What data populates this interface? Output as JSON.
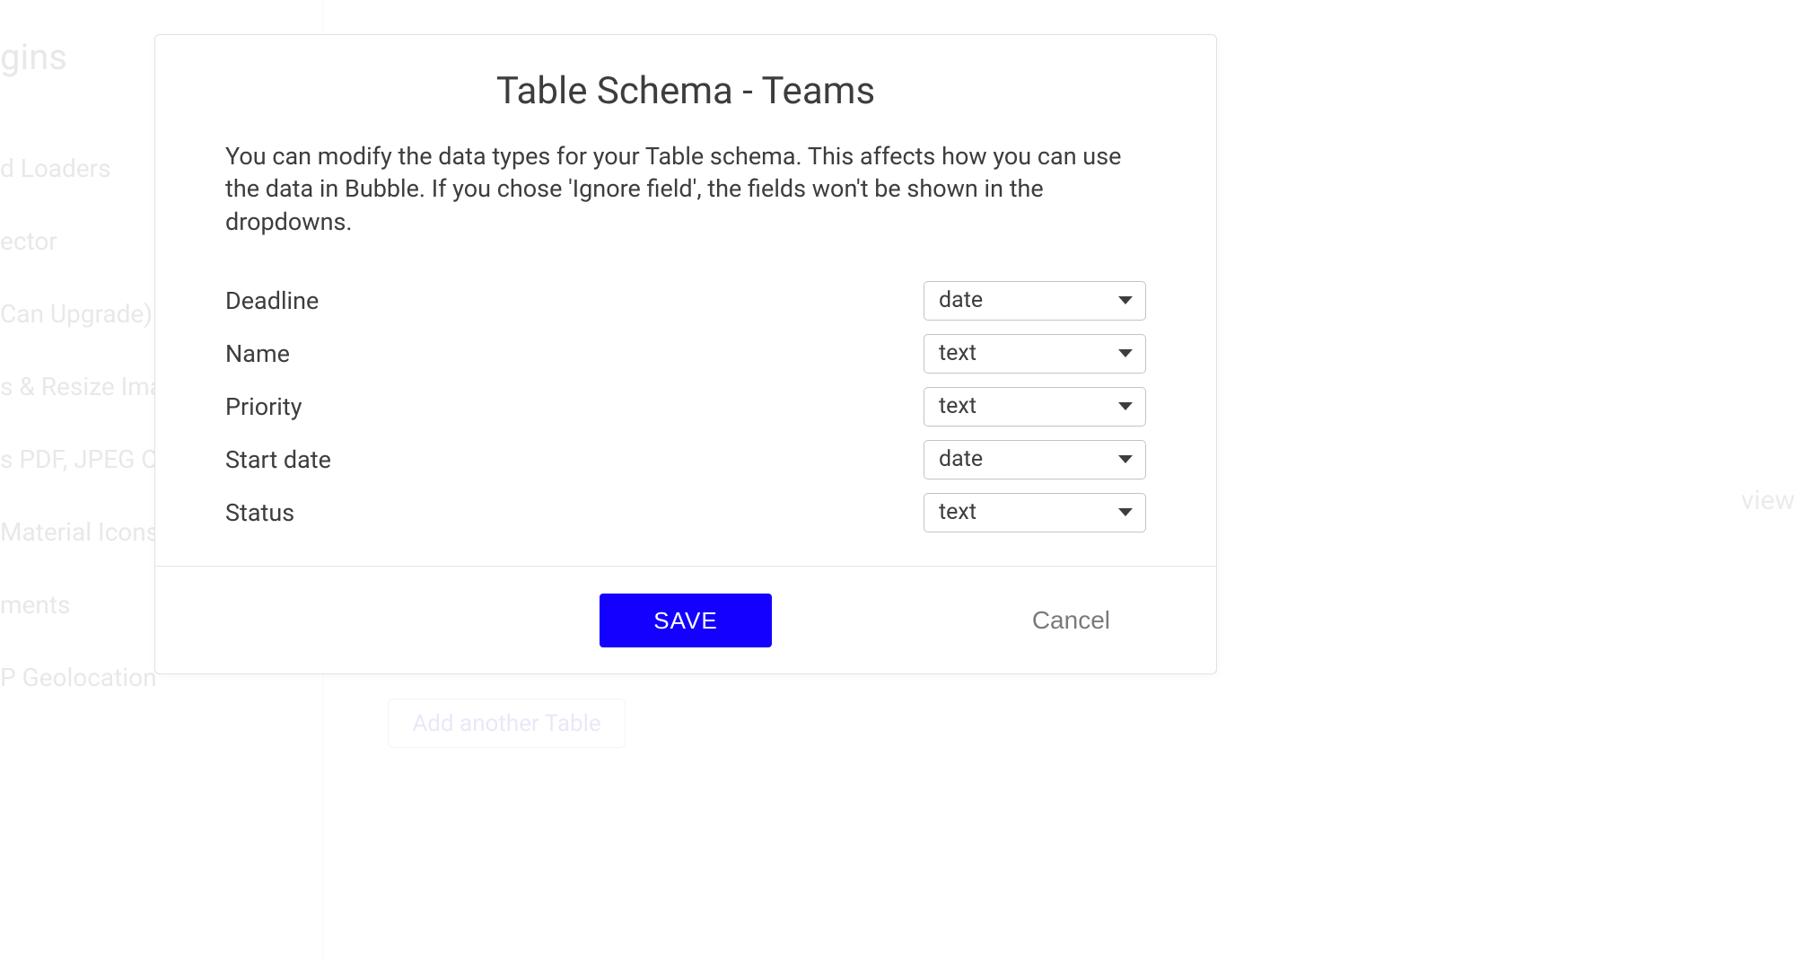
{
  "background": {
    "sidebar_heading": "gins",
    "sidebar_items": [
      "d Loaders",
      "ector",
      "Can Upgrade)",
      "s & Resize Images",
      "s PDF, JPEG Or PN",
      "Material Icons",
      "ments",
      "P Geolocation"
    ],
    "right_text": "view",
    "add_button": "Add another Table"
  },
  "modal": {
    "title": "Table Schema - Teams",
    "description": "You can modify the data types for your Table schema. This affects how you can use the data in Bubble. If you chose 'Ignore field', the fields won't be shown in the dropdowns.",
    "fields": [
      {
        "label": "Deadline",
        "type": "date"
      },
      {
        "label": "Name",
        "type": "text"
      },
      {
        "label": "Priority",
        "type": "text"
      },
      {
        "label": "Start date",
        "type": "date"
      },
      {
        "label": "Status",
        "type": "text"
      }
    ],
    "save_label": "SAVE",
    "cancel_label": "Cancel"
  }
}
